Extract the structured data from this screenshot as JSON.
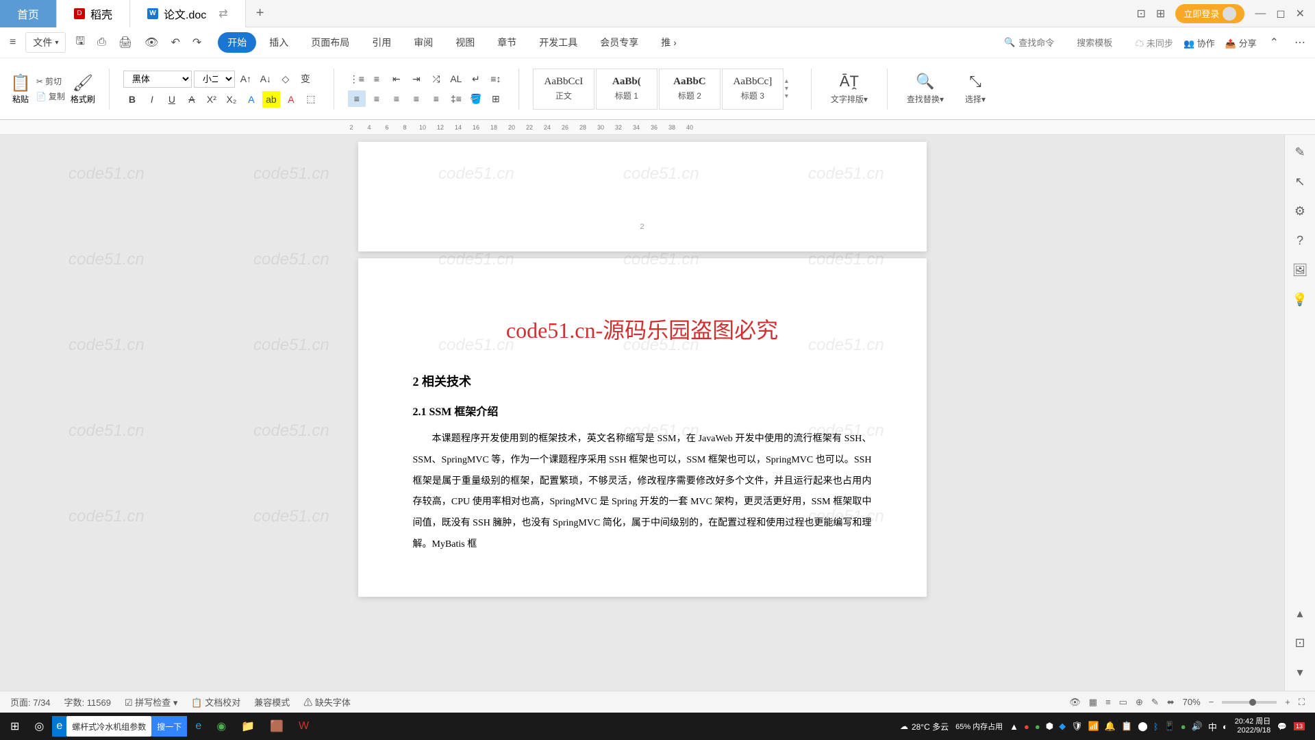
{
  "tabs": {
    "home": "首页",
    "dk": "稻壳",
    "doc": "论文.doc"
  },
  "title_right": {
    "login": "立即登录"
  },
  "menu": {
    "file": "文件"
  },
  "nav": [
    "开始",
    "插入",
    "页面布局",
    "引用",
    "审阅",
    "视图",
    "章节",
    "开发工具",
    "会员专享",
    "推"
  ],
  "search": {
    "cmd": "查找命令",
    "tpl": "搜索模板"
  },
  "sync": {
    "unsync": "未同步",
    "collab": "协作",
    "share": "分享"
  },
  "clipboard": {
    "paste": "粘贴",
    "cut": "剪切",
    "copy": "复制",
    "format": "格式刷"
  },
  "font": {
    "name": "黑体",
    "size": "小二"
  },
  "styles": [
    {
      "preview": "AaBbCcI",
      "name": "正文"
    },
    {
      "preview": "AaBb(",
      "name": "标题 1"
    },
    {
      "preview": "AaBbC",
      "name": "标题 2"
    },
    {
      "preview": "AaBbCc]",
      "name": "标题 3"
    }
  ],
  "actions": {
    "layout": "文字排版",
    "find": "查找替换",
    "select": "选择"
  },
  "doc": {
    "prev_page_num": "2",
    "banner": "code51.cn-源码乐园盗图必究",
    "h2": "2  相关技术",
    "h3": "2.1 SSM 框架介绍",
    "p1": "本课题程序开发使用到的框架技术，英文名称缩写是 SSM，在 JavaWeb 开发中使用的流行框架有 SSH、SSM、SpringMVC 等，作为一个课题程序采用 SSH 框架也可以，SSM 框架也可以，SpringMVC 也可以。SSH 框架是属于重量级别的框架，配置繁琐，不够灵活，修改程序需要修改好多个文件，并且运行起来也占用内存较高，CPU 使用率相对也高，SpringMVC 是 Spring 开发的一套 MVC 架构，更灵活更好用，SSM 框架取中间值，既没有 SSH 臃肿，也没有 SpringMVC 简化，属于中间级别的，在配置过程和使用过程也更能编写和理解。MyBatis 框"
  },
  "status": {
    "page": "页面: 7/34",
    "words": "字数: 11569",
    "spell": "拼写检查",
    "proof": "文档校对",
    "compat": "兼容模式",
    "missing": "缺失字体",
    "zoom": "70%"
  },
  "taskbar": {
    "search": "螺杆式冷水机组参数",
    "searchbtn": "搜一下",
    "weather": "28°C 多云",
    "memory": "65% 内存占用",
    "time": "20:42 周日",
    "date": "2022/9/18"
  },
  "watermark": "code51.cn"
}
